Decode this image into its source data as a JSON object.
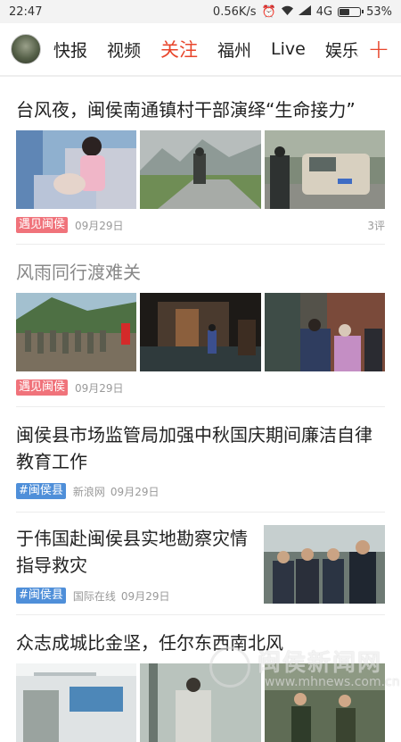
{
  "status": {
    "time": "22:47",
    "network_speed": "0.56K/s",
    "network_type": "4G",
    "battery": "53%",
    "battery_level": 0.53
  },
  "nav": {
    "tabs": [
      {
        "label": "快报"
      },
      {
        "label": "视频"
      },
      {
        "label": "关注"
      },
      {
        "label": "福州"
      },
      {
        "label": "Live"
      },
      {
        "label": "娱乐"
      }
    ],
    "active_tab": "关注",
    "add_label": "+"
  },
  "feed": [
    {
      "title": "台风夜，闽侯南通镇村干部演绎“生命接力”",
      "tag": "遇见闽侯",
      "date": "09月29日",
      "comments": "3评"
    },
    {
      "title": "风雨同行渡难关",
      "tag": "遇见闽侯",
      "date": "09月29日"
    },
    {
      "title": "闽侯县市场监管局加强中秋国庆期间廉洁自律教育工作",
      "tag": "#闽侯县",
      "source": "新浪网",
      "date": "09月29日"
    },
    {
      "title": "于伟国赴闽侯县实地勘察灾情指导救灾",
      "tag": "#闽侯县",
      "source": "国际在线",
      "date": "09月29日"
    },
    {
      "title": "众志成城比金坚，任尔东西南北风"
    }
  ],
  "watermark": {
    "text": "闽侯新闻网",
    "url": "www.mhnews.com.cn"
  },
  "colors": {
    "accent": "#e8462c",
    "tag_red": "#f0737b",
    "tag_blue": "#4f8fd9"
  }
}
